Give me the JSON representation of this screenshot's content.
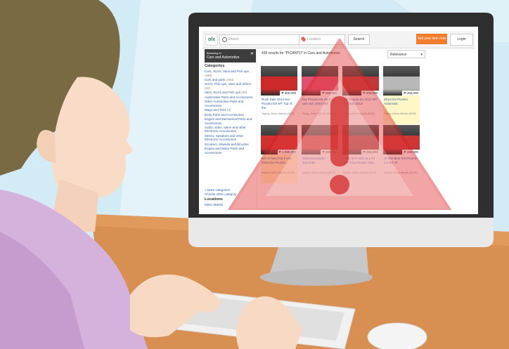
{
  "screen": {
    "header": {
      "logo": "olx",
      "search_placeholder": "Search",
      "location_placeholder": "Location",
      "search_button": "Search",
      "sell_button": "Sell your item now",
      "login": "Login"
    },
    "sidebar": {
      "browse_subtitle": "Browsing in",
      "browse_category": "Cars and Automotive",
      "close_icon": "close-icon",
      "categories_title": "Categories",
      "categories": [
        {
          "label": "Cars, SUVs, Vans and Pick ups",
          "count": "(435)"
        },
        {
          "label": "Cars and parts",
          "count": "(403)"
        },
        {
          "label": "SUVs, Pick-ups, Vans and others",
          "count": "(32)"
        },
        {
          "label": "Vans, SUVs and Pick ups",
          "count": "(20)"
        },
        {
          "label": "Automotive Parts and Accessories",
          "count": ""
        },
        {
          "label": "Other Automotive Parts and Accessories",
          "count": ""
        },
        {
          "label": "Mags and Tires",
          "count": "(3)"
        },
        {
          "label": "Body Parts and Accessories",
          "count": ""
        },
        {
          "label": "Engine and Mechanical Parts and Accessories",
          "count": ""
        },
        {
          "label": "Audio, video, alarm and other Electronic Accessories",
          "count": ""
        },
        {
          "label": "Stereo, Speakers and other Electronic Accessories",
          "count": ""
        },
        {
          "label": "Scooters, Mopeds and Bicycles",
          "count": ""
        },
        {
          "label": "Engine and Motor Parts and Accessories",
          "count": ""
        }
      ],
      "more_link": "+ More categories",
      "change_link": "Choose other category",
      "locations_title": "Locations",
      "location_value": "Metro Manila"
    },
    "results_title": "435 results for \"PICANTO\" in Cars and Automotive",
    "sort_value": "Relevance",
    "listings": [
      {
        "title": "Rush Sale 2014 Kia Picanto EX MT Top of the",
        "price": "₱ 300,000",
        "location": "Taguig, Metro Manila (NCR)",
        "color": "#cc2a2a",
        "highlight": false
      },
      {
        "title": "Kia Picanto Mt 2012 1.1 pa2 owl, 2013 mdl",
        "price": "₱ 260,000",
        "location": "Pasig, Metro Manila (NCR)",
        "color": "#e05070",
        "highlight": false
      },
      {
        "title": "Kia Picanto Ex 2013 MT w/ Pearl 2013",
        "price": "₱ 300,000",
        "location": "Pasig, Metro Manila (NCR)",
        "color": "#c03838",
        "highlight": false
      },
      {
        "title": "2014 Kia Picanto Automatic",
        "price": "₱ 450,000",
        "location": "Pasay, Metro Manila (NCR)",
        "color": "#b8b8b8",
        "highlight": true
      },
      {
        "title": "Kia All New Kia Forte 2016 Kia Picanto",
        "price": "₱ 1,090,000",
        "location": "Manila, Metro Manila (NCR)",
        "color": "#d03030",
        "highlight": true
      },
      {
        "title": "2015 kia picanto automatic",
        "price": "₱ 285,000",
        "location": "Manila, Metro Manila (NCR)",
        "color": "#d04a4a",
        "highlight": false
      },
      {
        "title": "THIS IS IT 50K ALL IN 2017 Kia Picanto auto",
        "price": "₱ 450,000",
        "location": "Makati, Metro Manila (NCR)",
        "color": "#a82828",
        "highlight": false
      },
      {
        "title": "Hi The Best Kia Picanto 1.0 EX AT",
        "price": "₱ 320,000",
        "location": "Manila, Metro Manila (NCR)",
        "color": "#cc3636",
        "highlight": false
      }
    ]
  }
}
